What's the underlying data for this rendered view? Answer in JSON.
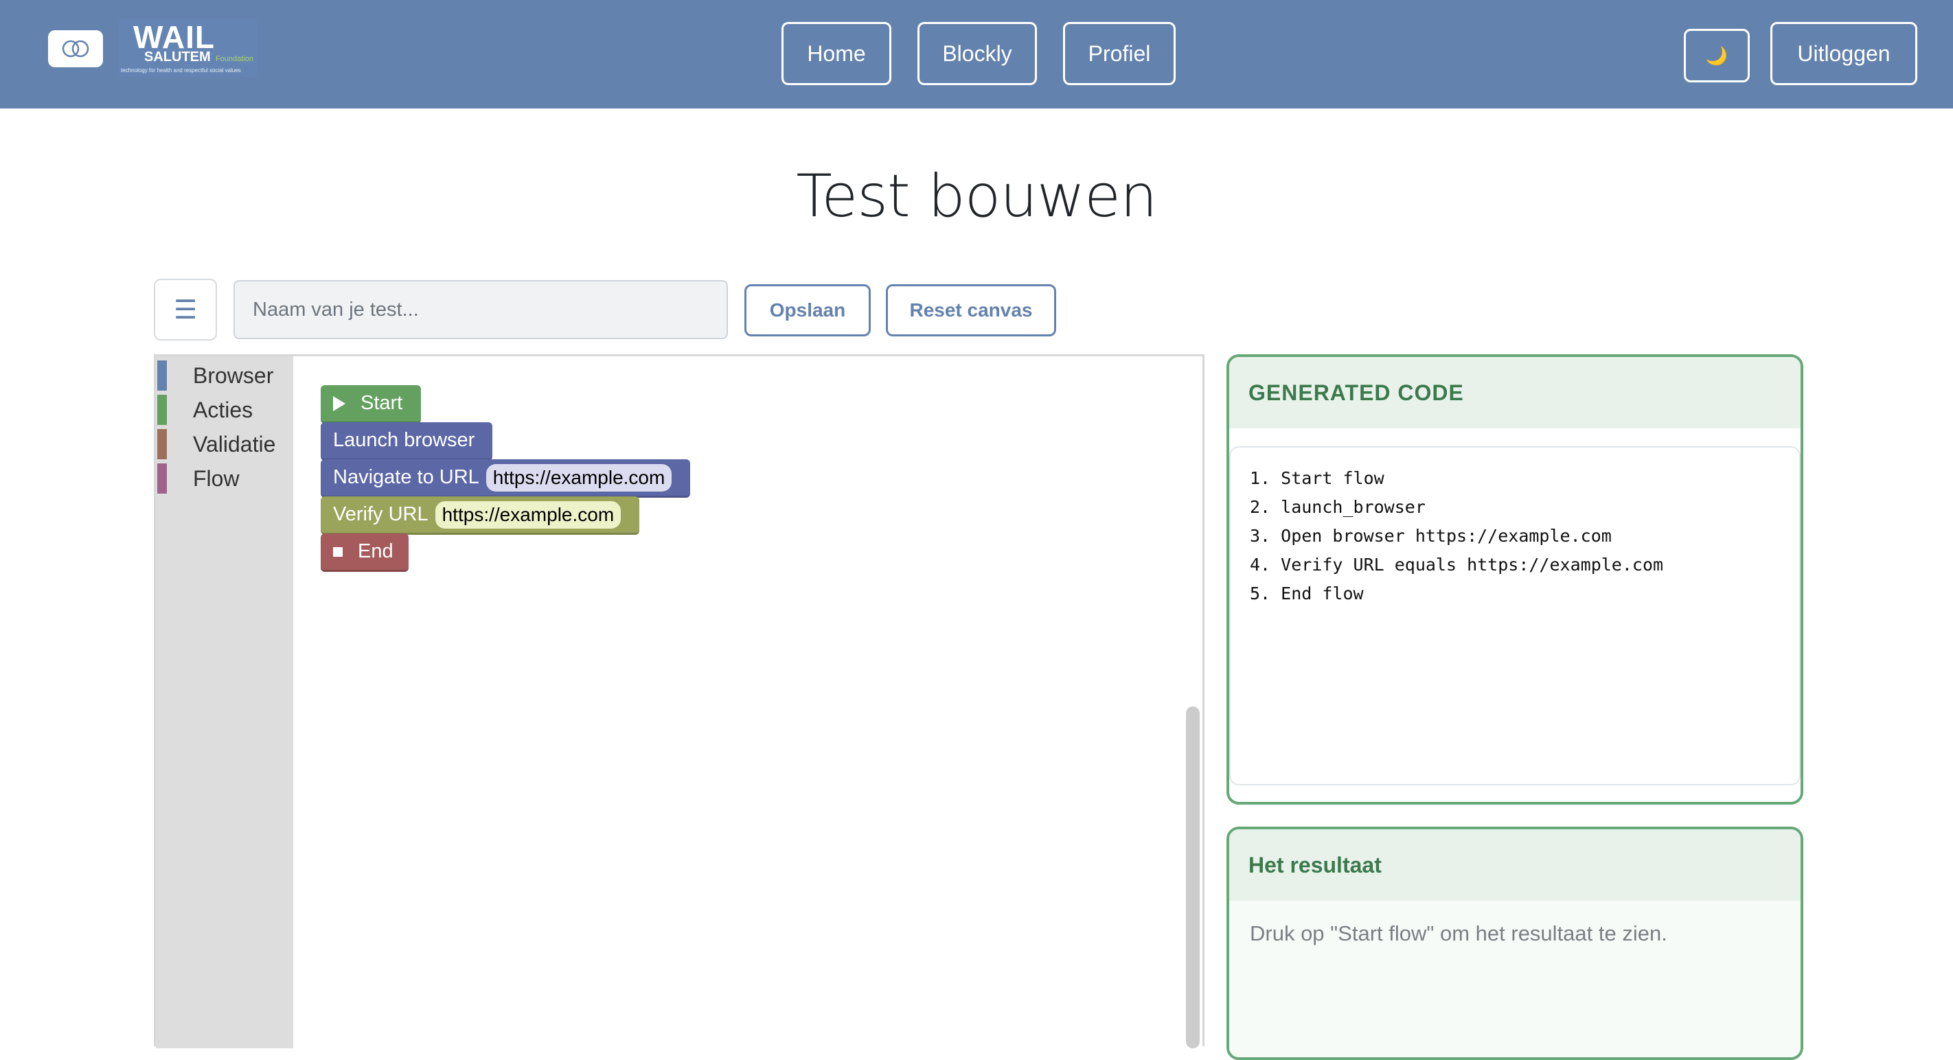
{
  "navbar": {
    "logo": {
      "title": "WAIL",
      "subtitle": "SALUTEM",
      "foundation": "Foundation",
      "tagline": "technology for health and respectful social values"
    },
    "links": [
      "Home",
      "Blockly",
      "Profiel"
    ],
    "theme_toggle_icon": "moon-icon",
    "theme_toggle_glyph": "🌙",
    "logout_label": "Uitloggen"
  },
  "page": {
    "title": "Test bouwen"
  },
  "toolbar": {
    "menu_glyph": "☰",
    "test_name_placeholder": "Naam van je test...",
    "test_name_value": "",
    "save_label": "Opslaan",
    "reset_label": "Reset canvas"
  },
  "workspace": {
    "categories": [
      {
        "label": "Browser",
        "color": "#6382ad"
      },
      {
        "label": "Acties",
        "color": "#64a05f"
      },
      {
        "label": "Validatie",
        "color": "#9b6f5a"
      },
      {
        "label": "Flow",
        "color": "#a0628a"
      }
    ],
    "blocks": {
      "start": "Start",
      "launch": "Launch browser",
      "navigate": "Navigate to URL",
      "navigate_url": "https://example.com",
      "verify": "Verify URL",
      "verify_url": "https://example.com",
      "end": "End"
    },
    "colors": {
      "start": "#64a05f",
      "browser": "#5c68a6",
      "validation": "#9aa55b",
      "end": "#a55b5b"
    }
  },
  "code_panel": {
    "title": "GENERATED CODE",
    "lines": [
      "1. Start flow",
      "2. launch_browser",
      "3. Open browser https://example.com",
      "4. Verify URL equals https://example.com",
      "5. End flow"
    ]
  },
  "result_panel": {
    "title": "Het resultaat",
    "placeholder": "Druk op \"Start flow\" om het resultaat te zien."
  },
  "theme": {
    "navbar": "#6382ad",
    "accent_green": "#66a877"
  }
}
